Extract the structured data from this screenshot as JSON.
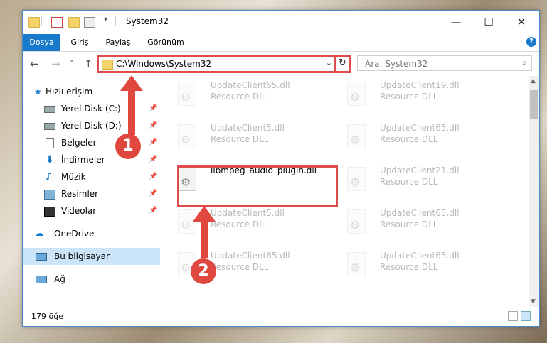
{
  "window": {
    "title": "System32",
    "controls": {
      "minimize": "—",
      "maximize": "☐",
      "close": "✕"
    }
  },
  "ribbon": {
    "tabs": [
      "Dosya",
      "Giriş",
      "Paylaş",
      "Görünüm"
    ],
    "help": "?"
  },
  "nav": {
    "back": "←",
    "forward": "→",
    "recent": "˅",
    "up": "↑",
    "address": "C:\\Windows\\System32",
    "address_chevron": "⌄",
    "refresh": "↻",
    "search_placeholder": "Ara: System32",
    "search_icon": "⌕"
  },
  "sidebar": {
    "items": [
      {
        "label": "Hızlı erişim",
        "icon": "star-icon"
      },
      {
        "label": "Yerel Disk (C:)",
        "icon": "drive-icon"
      },
      {
        "label": "Yerel Disk (D:)",
        "icon": "drive-icon"
      },
      {
        "label": "Belgeler",
        "icon": "documents-icon"
      },
      {
        "label": "İndirmeler",
        "icon": "download-icon"
      },
      {
        "label": "Müzik",
        "icon": "music-icon"
      },
      {
        "label": "Resimler",
        "icon": "pictures-icon"
      },
      {
        "label": "Videolar",
        "icon": "video-icon"
      },
      {
        "label": "OneDrive",
        "icon": "cloud-icon"
      },
      {
        "label": "Bu bilgisayar",
        "icon": "computer-icon"
      },
      {
        "label": "Ağ",
        "icon": "network-icon"
      }
    ],
    "pin": "📌"
  },
  "files": [
    {
      "name": "UpdateClient65.dll",
      "type": "Resource DLL"
    },
    {
      "name": "UpdateClient19.dll",
      "type": "Resource DLL"
    },
    {
      "name": "UpdateClient5.dll",
      "type": "Resource DLL"
    },
    {
      "name": "UpdateClient65.dll",
      "type": "Resource DLL"
    },
    {
      "name": "libmpeg_audio_plugin.dll",
      "type": ""
    },
    {
      "name": "UpdateClient21.dll",
      "type": "Resource DLL"
    },
    {
      "name": "UpdateClient5.dll",
      "type": "Resource DLL"
    },
    {
      "name": "UpdateClient65.dll",
      "type": "Resource DLL"
    },
    {
      "name": "UpdateClient65.dll",
      "type": "Resource DLL"
    },
    {
      "name": "UpdateClient65.dll",
      "type": "Resource DLL"
    }
  ],
  "status": {
    "count": "179 öğe"
  },
  "callouts": [
    "1",
    "2"
  ],
  "colors": {
    "accent": "#1979ca",
    "highlight": "#e04b4b"
  }
}
